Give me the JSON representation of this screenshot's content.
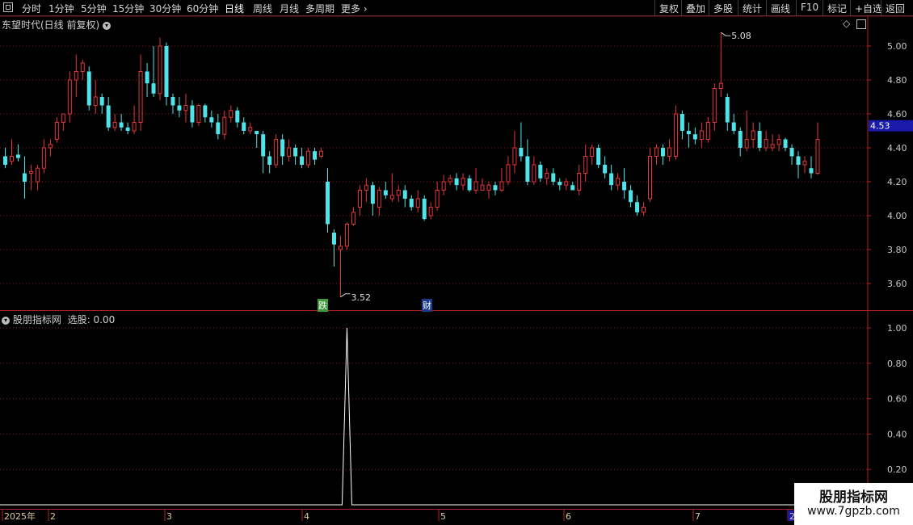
{
  "toolbar": {
    "periods": [
      "分时",
      "1分钟",
      "5分钟",
      "15分钟",
      "30分钟",
      "60分钟",
      "日线",
      "周线",
      "月线",
      "多周期",
      "更多"
    ],
    "active_period": "日线",
    "right_buttons": [
      "复权",
      "叠加",
      "多股",
      "统计",
      "画线",
      "F10",
      "标记",
      "+自选",
      "返回"
    ]
  },
  "main_panel": {
    "title": "东望时代(日线 前复权)",
    "y_ticks": [
      "5.00",
      "4.80",
      "4.60",
      "4.40",
      "4.20",
      "4.00",
      "3.80",
      "3.60"
    ],
    "current_price": "4.53",
    "high_label": "5.08",
    "low_label": "3.52",
    "signals": [
      {
        "text": "跌",
        "color": "#3c9a3c"
      },
      {
        "text": "财",
        "color": "#1c3a8a"
      }
    ]
  },
  "sub_panel": {
    "title": "股朋指标网",
    "value_label": "选股: 0.00",
    "y_ticks": [
      "1.00",
      "0.80",
      "0.60",
      "0.40",
      "0.20"
    ]
  },
  "x_axis": {
    "labels": [
      "2025年",
      "2",
      "3",
      "4",
      "5",
      "6",
      "7",
      "2"
    ]
  },
  "watermark": {
    "line1": "股朋指标网",
    "line2": "www.7gpzb.com"
  },
  "colors": {
    "up": "#e5363a",
    "down": "#4fe3ea",
    "grid": "#8a1f1f",
    "axis_text": "#c8c8c8",
    "price_tag_bg": "#1a1aa8"
  },
  "chart_data": {
    "type": "candlestick",
    "price_range": [
      3.45,
      5.15
    ],
    "candles": [
      [
        4.35,
        4.3,
        4.4,
        4.28
      ],
      [
        4.32,
        4.35,
        4.45,
        4.3
      ],
      [
        4.36,
        4.34,
        4.42,
        4.32
      ],
      [
        4.25,
        4.2,
        4.35,
        4.1
      ],
      [
        4.25,
        4.26,
        4.3,
        4.15
      ],
      [
        4.2,
        4.28,
        4.3,
        4.15
      ],
      [
        4.28,
        4.4,
        4.45,
        4.25
      ],
      [
        4.4,
        4.42,
        4.45,
        4.35
      ],
      [
        4.45,
        4.55,
        4.58,
        4.43
      ],
      [
        4.55,
        4.6,
        4.6,
        4.5
      ],
      [
        4.6,
        4.8,
        4.85,
        4.55
      ],
      [
        4.8,
        4.85,
        4.95,
        4.7
      ],
      [
        4.85,
        4.9,
        4.92,
        4.8
      ],
      [
        4.85,
        4.65,
        4.88,
        4.62
      ],
      [
        4.65,
        4.7,
        4.8,
        4.6
      ],
      [
        4.7,
        4.65,
        4.72,
        4.6
      ],
      [
        4.65,
        4.52,
        4.7,
        4.5
      ],
      [
        4.52,
        4.55,
        4.6,
        4.5
      ],
      [
        4.55,
        4.52,
        4.6,
        4.5
      ],
      [
        4.52,
        4.5,
        4.55,
        4.48
      ],
      [
        4.5,
        4.55,
        4.65,
        4.48
      ],
      [
        4.55,
        4.85,
        4.95,
        4.5
      ],
      [
        4.85,
        4.78,
        4.9,
        4.7
      ],
      [
        4.78,
        4.72,
        5.0,
        4.7
      ],
      [
        4.72,
        5.0,
        5.05,
        4.68
      ],
      [
        5.0,
        4.7,
        5.02,
        4.65
      ],
      [
        4.7,
        4.65,
        4.72,
        4.6
      ],
      [
        4.65,
        4.62,
        4.7,
        4.58
      ],
      [
        4.62,
        4.65,
        4.72,
        4.55
      ],
      [
        4.65,
        4.55,
        4.68,
        4.52
      ],
      [
        4.55,
        4.65,
        4.66,
        4.53
      ],
      [
        4.65,
        4.58,
        4.66,
        4.55
      ],
      [
        4.58,
        4.55,
        4.62,
        4.52
      ],
      [
        4.55,
        4.48,
        4.6,
        4.45
      ],
      [
        4.48,
        4.58,
        4.62,
        4.45
      ],
      [
        4.58,
        4.62,
        4.65,
        4.55
      ],
      [
        4.62,
        4.55,
        4.64,
        4.52
      ],
      [
        4.55,
        4.5,
        4.58,
        4.48
      ],
      [
        4.5,
        4.52,
        4.55,
        4.48
      ],
      [
        4.5,
        4.48,
        4.5,
        4.4
      ],
      [
        4.48,
        4.35,
        4.5,
        4.25
      ],
      [
        4.35,
        4.3,
        4.38,
        4.25
      ],
      [
        4.3,
        4.45,
        4.48,
        4.28
      ],
      [
        4.45,
        4.35,
        4.48,
        4.3
      ],
      [
        4.35,
        4.4,
        4.45,
        4.32
      ],
      [
        4.4,
        4.35,
        4.42,
        4.3
      ],
      [
        4.35,
        4.3,
        4.4,
        4.28
      ],
      [
        4.3,
        4.38,
        4.4,
        4.28
      ],
      [
        4.38,
        4.33,
        4.4,
        4.3
      ],
      [
        4.35,
        4.38,
        4.4,
        4.34
      ],
      [
        4.2,
        3.95,
        4.28,
        3.9
      ],
      [
        3.9,
        3.83,
        3.92,
        3.7
      ],
      [
        3.8,
        3.82,
        3.88,
        3.52
      ],
      [
        3.82,
        3.95,
        3.96,
        3.8
      ],
      [
        3.95,
        4.02,
        4.05,
        3.94
      ],
      [
        4.05,
        4.15,
        4.18,
        4.0
      ],
      [
        4.15,
        4.18,
        4.22,
        4.08
      ],
      [
        4.18,
        4.07,
        4.2,
        4.0
      ],
      [
        4.05,
        4.15,
        4.17,
        4.0
      ],
      [
        4.15,
        4.12,
        4.2,
        4.1
      ],
      [
        4.1,
        4.12,
        4.25,
        4.08
      ],
      [
        4.12,
        4.15,
        4.18,
        4.08
      ],
      [
        4.15,
        4.1,
        4.18,
        4.05
      ],
      [
        4.1,
        4.05,
        4.12,
        4.03
      ],
      [
        4.05,
        4.1,
        4.15,
        4.02
      ],
      [
        4.1,
        3.98,
        4.12,
        3.97
      ],
      [
        4.0,
        4.05,
        4.08,
        3.98
      ],
      [
        4.05,
        4.15,
        4.2,
        4.03
      ],
      [
        4.15,
        4.2,
        4.24,
        4.12
      ],
      [
        4.2,
        4.22,
        4.24,
        4.18
      ],
      [
        4.22,
        4.18,
        4.25,
        4.15
      ],
      [
        4.18,
        4.22,
        4.25,
        4.15
      ],
      [
        4.22,
        4.15,
        4.24,
        4.14
      ],
      [
        4.15,
        4.2,
        4.28,
        4.13
      ],
      [
        4.15,
        4.18,
        4.22,
        4.15
      ],
      [
        4.15,
        4.18,
        4.2,
        4.1
      ],
      [
        4.18,
        4.15,
        4.2,
        4.12
      ],
      [
        4.15,
        4.2,
        4.28,
        4.14
      ],
      [
        4.2,
        4.3,
        4.35,
        4.18
      ],
      [
        4.3,
        4.4,
        4.5,
        4.25
      ],
      [
        4.4,
        4.35,
        4.55,
        4.32
      ],
      [
        4.35,
        4.2,
        4.45,
        4.18
      ],
      [
        4.2,
        4.3,
        4.35,
        4.18
      ],
      [
        4.3,
        4.22,
        4.32,
        4.2
      ],
      [
        4.22,
        4.25,
        4.28,
        4.18
      ],
      [
        4.25,
        4.2,
        4.28,
        4.18
      ],
      [
        4.2,
        4.18,
        4.22,
        4.15
      ],
      [
        4.18,
        4.2,
        4.22,
        4.15
      ],
      [
        4.18,
        4.15,
        4.2,
        4.15
      ],
      [
        4.15,
        4.25,
        4.3,
        4.12
      ],
      [
        4.25,
        4.35,
        4.42,
        4.2
      ],
      [
        4.35,
        4.4,
        4.42,
        4.3
      ],
      [
        4.4,
        4.3,
        4.42,
        4.28
      ],
      [
        4.3,
        4.25,
        4.35,
        4.22
      ],
      [
        4.25,
        4.18,
        4.3,
        4.15
      ],
      [
        4.18,
        4.22,
        4.25,
        4.15
      ],
      [
        4.2,
        4.15,
        4.28,
        4.1
      ],
      [
        4.15,
        4.08,
        4.18,
        4.05
      ],
      [
        4.08,
        4.02,
        4.12,
        4.0
      ],
      [
        4.02,
        4.05,
        4.08,
        4.0
      ],
      [
        4.1,
        4.35,
        4.4,
        4.08
      ],
      [
        4.35,
        4.4,
        4.42,
        4.3
      ],
      [
        4.4,
        4.35,
        4.42,
        4.3
      ],
      [
        4.35,
        4.4,
        4.45,
        4.32
      ],
      [
        4.35,
        4.6,
        4.65,
        4.33
      ],
      [
        4.6,
        4.5,
        4.62,
        4.45
      ],
      [
        4.5,
        4.48,
        4.55,
        4.4
      ],
      [
        4.48,
        4.45,
        4.52,
        4.42
      ],
      [
        4.45,
        4.5,
        4.55,
        4.4
      ],
      [
        4.45,
        4.55,
        4.58,
        4.43
      ],
      [
        4.55,
        4.75,
        4.78,
        4.5
      ],
      [
        4.75,
        4.78,
        5.08,
        4.7
      ],
      [
        4.7,
        4.55,
        4.72,
        4.5
      ],
      [
        4.55,
        4.5,
        4.6,
        4.48
      ],
      [
        4.5,
        4.4,
        4.52,
        4.35
      ],
      [
        4.4,
        4.45,
        4.62,
        4.38
      ],
      [
        4.45,
        4.5,
        4.55,
        4.4
      ],
      [
        4.5,
        4.4,
        4.55,
        4.38
      ],
      [
        4.4,
        4.45,
        4.5,
        4.38
      ],
      [
        4.4,
        4.42,
        4.48,
        4.38
      ],
      [
        4.42,
        4.45,
        4.48,
        4.38
      ],
      [
        4.45,
        4.4,
        4.46,
        4.38
      ],
      [
        4.4,
        4.35,
        4.42,
        4.3
      ],
      [
        4.35,
        4.3,
        4.38,
        4.22
      ],
      [
        4.3,
        4.32,
        4.35,
        4.25
      ],
      [
        4.28,
        4.25,
        4.35,
        4.22
      ],
      [
        4.25,
        4.45,
        4.55,
        4.24
      ]
    ],
    "signal_series": {
      "name": "选股",
      "peak_value": 1.0,
      "peak_date_index": 53,
      "ylim": [
        0,
        1.05
      ]
    }
  }
}
